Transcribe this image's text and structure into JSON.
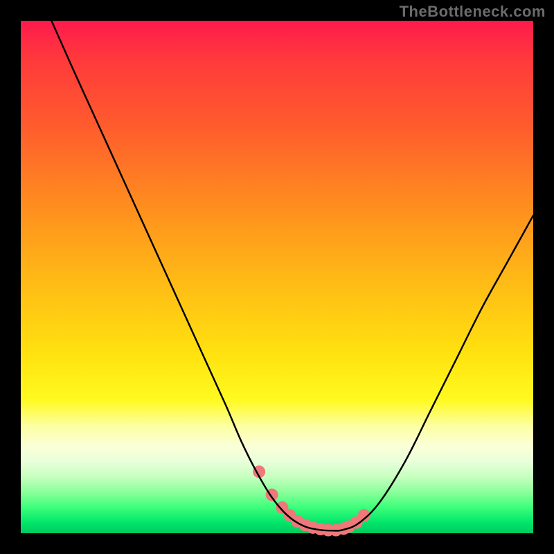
{
  "watermark": "TheBottleneck.com",
  "chart_data": {
    "type": "line",
    "title": "",
    "xlabel": "",
    "ylabel": "",
    "xlim": [
      0,
      100
    ],
    "ylim": [
      0,
      100
    ],
    "grid": false,
    "background_gradient": {
      "direction": "vertical",
      "stops": [
        {
          "pos": 0.0,
          "color": "#ff1a4d"
        },
        {
          "pos": 0.08,
          "color": "#ff3b3b"
        },
        {
          "pos": 0.2,
          "color": "#ff5a2e"
        },
        {
          "pos": 0.35,
          "color": "#ff8a1f"
        },
        {
          "pos": 0.5,
          "color": "#ffb816"
        },
        {
          "pos": 0.65,
          "color": "#ffe20f"
        },
        {
          "pos": 0.74,
          "color": "#fffa20"
        },
        {
          "pos": 0.79,
          "color": "#fcffa0"
        },
        {
          "pos": 0.83,
          "color": "#fbffd8"
        },
        {
          "pos": 0.86,
          "color": "#e8ffda"
        },
        {
          "pos": 0.89,
          "color": "#c6ffbf"
        },
        {
          "pos": 0.92,
          "color": "#8aff9a"
        },
        {
          "pos": 0.95,
          "color": "#3bff7a"
        },
        {
          "pos": 0.98,
          "color": "#00e56a"
        },
        {
          "pos": 1.0,
          "color": "#00c95d"
        }
      ]
    },
    "series": [
      {
        "name": "bottleneck-curve",
        "color": "#000000",
        "stroke_width": 2.5,
        "x": [
          6,
          10,
          15,
          20,
          25,
          30,
          35,
          40,
          43,
          46,
          49,
          52,
          55,
          58,
          61,
          63,
          66,
          70,
          75,
          80,
          85,
          90,
          95,
          100
        ],
        "y": [
          100,
          91,
          80,
          69,
          58,
          47,
          36,
          25,
          18,
          12,
          7,
          3.5,
          1.5,
          0.7,
          0.5,
          0.7,
          2,
          6,
          14,
          24,
          34,
          44,
          53,
          62
        ]
      }
    ],
    "markers": {
      "name": "highlight-segment",
      "color": "#f0787a",
      "radius_px": 9,
      "x": [
        46.5,
        49,
        51,
        52.5,
        54,
        55.5,
        57,
        58.5,
        60,
        61.5,
        63,
        64,
        65.5,
        67
      ],
      "y": [
        12,
        7.5,
        5,
        3.5,
        2.3,
        1.6,
        1.1,
        0.8,
        0.6,
        0.6,
        0.9,
        1.3,
        2.1,
        3.5
      ]
    }
  }
}
